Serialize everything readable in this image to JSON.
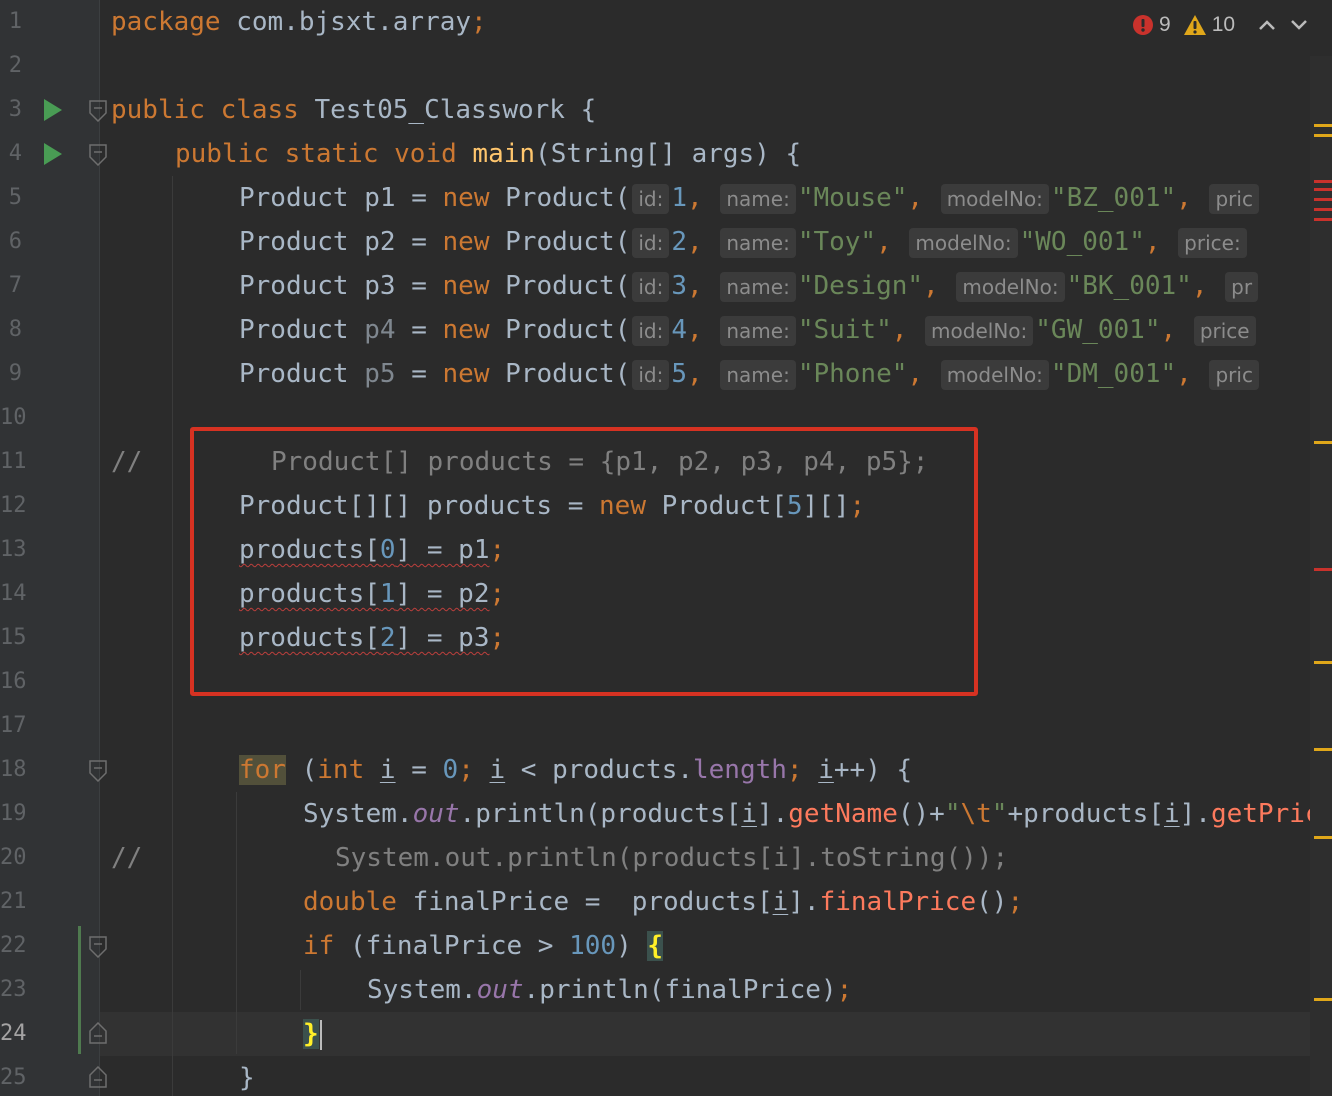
{
  "editor": {
    "file_package": "com.bjsxt.array",
    "class_name": "Test05_Classwork",
    "colors": {
      "background": "#2b2b2b",
      "keyword": "#cc7832",
      "string": "#6a8759",
      "number": "#6897bb",
      "highlight_box": "#d63222",
      "error": "#bc3f3c",
      "warning": "#e0a71a"
    }
  },
  "inspection": {
    "errors": "9",
    "warnings": "10",
    "error_icon": "error-badge-icon",
    "warning_icon": "warning-triangle-icon"
  },
  "gutter": {
    "line_numbers": [
      "1",
      "2",
      "3",
      "4",
      "5",
      "6",
      "7",
      "8",
      "9",
      "10",
      "11",
      "12",
      "13",
      "14",
      "15",
      "16",
      "17",
      "18",
      "19",
      "20",
      "21",
      "22",
      "23",
      "24",
      "25"
    ],
    "current_line": "24"
  },
  "code": {
    "l1": {
      "kw": "package",
      "rest": " com.bjsxt.array",
      "semi": ";"
    },
    "l3": {
      "kw": "public class",
      "name": " Test05_Classwork {"
    },
    "l4": {
      "kw": "public static void",
      "fn": "main",
      "rest": "(String[] args) {"
    },
    "products": [
      {
        "decl": "Product ",
        "var": "p1",
        "eq": " = ",
        "kw_new": "new",
        "ctor": " Product(",
        "h_id": "id:",
        "id": "1",
        "h_name": "name:",
        "name": "\"Mouse\"",
        "h_model": "modelNo:",
        "model": "\"BZ_001\"",
        "h_price": "pric"
      },
      {
        "decl": "Product ",
        "var": "p2",
        "eq": " = ",
        "kw_new": "new",
        "ctor": " Product(",
        "h_id": "id:",
        "id": "2",
        "h_name": "name:",
        "name": "\"Toy\"",
        "h_model": "modelNo:",
        "model": "\"WO_001\"",
        "h_price": "price:"
      },
      {
        "decl": "Product ",
        "var": "p3",
        "eq": " = ",
        "kw_new": "new",
        "ctor": " Product(",
        "h_id": "id:",
        "id": "3",
        "h_name": "name:",
        "name": "\"Design\"",
        "h_model": "modelNo:",
        "model": "\"BK_001\"",
        "h_price": "pr"
      },
      {
        "decl": "Product ",
        "var": "p4",
        "eq": " = ",
        "kw_new": "new",
        "ctor": " Product(",
        "h_id": "id:",
        "id": "4",
        "h_name": "name:",
        "name": "\"Suit\"",
        "h_model": "modelNo:",
        "model": "\"GW_001\"",
        "h_price": "price"
      },
      {
        "decl": "Product ",
        "var": "p5",
        "eq": " = ",
        "kw_new": "new",
        "ctor": " Product(",
        "h_id": "id:",
        "id": "5",
        "h_name": "name:",
        "name": "\"Phone\"",
        "h_model": "modelNo:",
        "model": "\"DM_001\"",
        "h_price": "pric"
      }
    ],
    "l11": {
      "comment_marker": "//",
      "text": "Product[] products = {p1, p2, p3, p4, p5};"
    },
    "l12": {
      "a": "Product[][] products = ",
      "kw": "new",
      "b": " Product[",
      "num": "5",
      "c": "][]",
      "semi": ";"
    },
    "assignments": [
      {
        "lhs": "products[",
        "idx": "0",
        "rhs": "] = p1",
        "semi": ";"
      },
      {
        "lhs": "products[",
        "idx": "1",
        "rhs": "] = p2",
        "semi": ";"
      },
      {
        "lhs": "products[",
        "idx": "2",
        "rhs": "] = p3",
        "semi": ";"
      }
    ],
    "l18": {
      "for": "for",
      "p1": " (",
      "int": "int",
      "i1": "i",
      "eq": " = ",
      "zero": "0",
      "s1": "; ",
      "i2": "i",
      "lt": " < products.",
      "len": "length",
      "s2": "; ",
      "i3": "i",
      "end": "++) {"
    },
    "l19": {
      "sys": "System.",
      "out": "out",
      "pr": ".println(products[",
      "i1": "i",
      "m1": "].",
      "getName": "getName",
      "m2": "()+",
      "s1": "\"",
      "esc": "\\t",
      "s2": "\"",
      "m3": "+products[",
      "i2": "i",
      "m4": "].",
      "getPri": "getPric"
    },
    "l20": {
      "comment_marker": "//",
      "text": "System.out.println(products[i].toString());"
    },
    "l21": {
      "dbl": "double",
      "a": " finalPrice =  products[",
      "i": "i",
      "b": "].",
      "fp": "finalPrice",
      "c": "()",
      "semi": ";"
    },
    "l22": {
      "kw": "if",
      "a": " (finalPrice > ",
      "num": "100",
      "b": ") ",
      "brace": "{"
    },
    "l23": {
      "sys": "System.",
      "out": "out",
      "a": ".println(finalPrice)",
      "semi": ";"
    },
    "l24": {
      "brace": "}"
    },
    "l25": {
      "brace": "}"
    }
  }
}
